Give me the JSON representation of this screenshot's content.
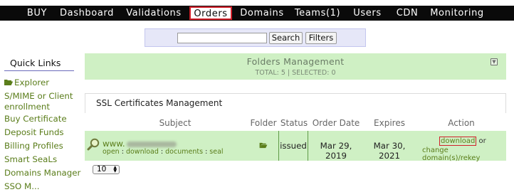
{
  "nav": {
    "items": [
      "BUY",
      "Dashboard",
      "Validations",
      "Orders",
      "Domains",
      "Teams(1)",
      "Users",
      "CDN",
      "Monitoring"
    ],
    "active": "Orders"
  },
  "search": {
    "value": "",
    "button": "Search",
    "filters_button": "Filters"
  },
  "sidebar": {
    "title": "Quick Links",
    "links": [
      "Explorer",
      "S/MIME or Client enrollment",
      "Buy Certificate",
      "Deposit Funds",
      "Billing Profiles",
      "Smart SeaLs",
      "Domains Manager",
      "SSO M..."
    ]
  },
  "folders": {
    "title": "Folders Management",
    "total": "TOTAL: 5 | SELECTED: 0"
  },
  "ssl": {
    "title": "SSL Certificates Management",
    "columns": [
      "Subject",
      "Folder",
      "Status",
      "Order Date",
      "Expires",
      "Action"
    ],
    "row": {
      "subject": "www.",
      "links": [
        "open",
        "download",
        "documents",
        "seal"
      ],
      "status": "issued",
      "order_date": "Mar 29, 2019",
      "expires": "Mar 30, 2021",
      "action_download": "download",
      "action_or": "or",
      "action_change": "change domain(s)/rekey"
    }
  },
  "pager": {
    "value": "10"
  },
  "colors": {
    "accent_green": "#5a7d1a",
    "panel_green": "#cff0c4",
    "active_tab_border": "#d0202a"
  }
}
